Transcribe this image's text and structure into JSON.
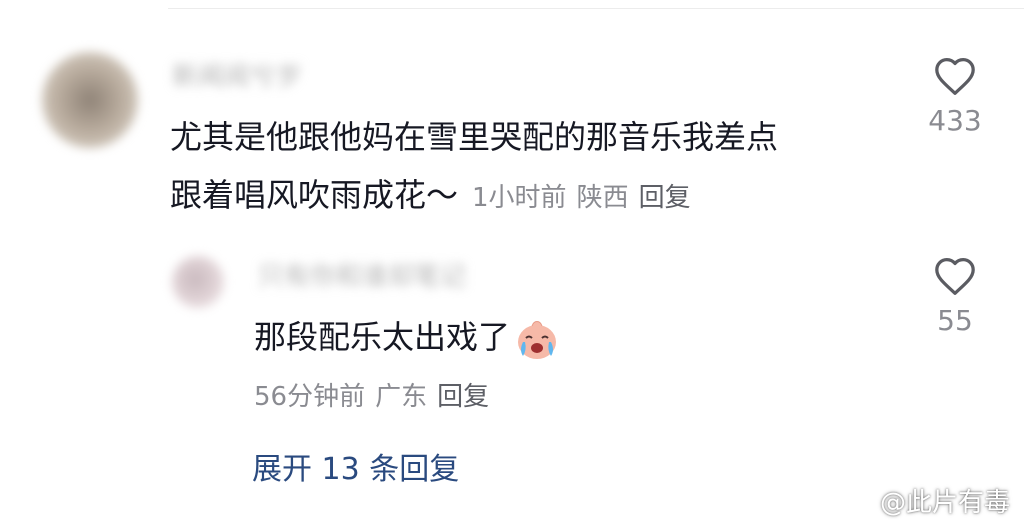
{
  "comment": {
    "author_name": "新闻阅兮岁",
    "text_line1": "尤其是他跟他妈在雪里哭配的那音乐我差点",
    "text_line2": "跟着唱风吹雨成花～",
    "time": "1小时前",
    "location": "陕西",
    "reply_label": "回复",
    "like_count": "433"
  },
  "reply": {
    "author_name": "只有你和谁却笔记",
    "text": "那段配乐太出戏了",
    "time": "56分钟前",
    "location": "广东",
    "reply_label": "回复",
    "like_count": "55"
  },
  "expand_label": "展开 13 条回复",
  "watermark": "@此片有毒",
  "icons": {
    "like": "heart-outline-icon",
    "emoji": "crying-face-emoji",
    "weibo": "weibo-logo-icon"
  },
  "colors": {
    "text": "#161823",
    "meta": "#8a8b91",
    "link": "#2a4a7f"
  }
}
